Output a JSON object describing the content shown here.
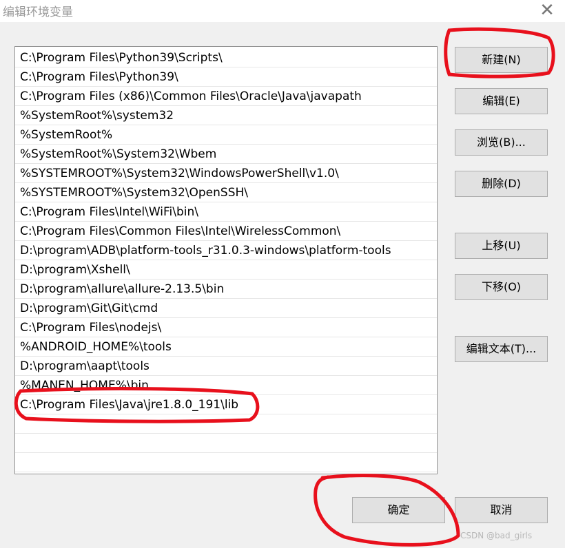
{
  "window": {
    "title": "编辑环境变量",
    "close_symbol": "✕"
  },
  "path_entries": [
    "C:\\Program Files\\Python39\\Scripts\\",
    "C:\\Program Files\\Python39\\",
    "C:\\Program Files (x86)\\Common Files\\Oracle\\Java\\javapath",
    "%SystemRoot%\\system32",
    "%SystemRoot%",
    "%SystemRoot%\\System32\\Wbem",
    "%SYSTEMROOT%\\System32\\WindowsPowerShell\\v1.0\\",
    "%SYSTEMROOT%\\System32\\OpenSSH\\",
    "C:\\Program Files\\Intel\\WiFi\\bin\\",
    "C:\\Program Files\\Common Files\\Intel\\WirelessCommon\\",
    "D:\\program\\ADB\\platform-tools_r31.0.3-windows\\platform-tools",
    "D:\\program\\Xshell\\",
    "D:\\program\\allure\\allure-2.13.5\\bin",
    "D:\\program\\Git\\Git\\cmd",
    "C:\\Program Files\\nodejs\\",
    "%ANDROID_HOME%\\tools",
    "D:\\program\\aapt\\tools",
    "%MANEN_HOME%\\bin",
    "C:\\Program Files\\Java\\jre1.8.0_191\\lib"
  ],
  "buttons": {
    "new": "新建(N)",
    "edit": "编辑(E)",
    "browse": "浏览(B)...",
    "delete": "删除(D)",
    "move_up": "上移(U)",
    "move_down": "下移(O)",
    "edit_text": "编辑文本(T)...",
    "ok": "确定",
    "cancel": "取消"
  },
  "annotation_color": "#e8101c",
  "watermark": "CSDN @bad_girls"
}
